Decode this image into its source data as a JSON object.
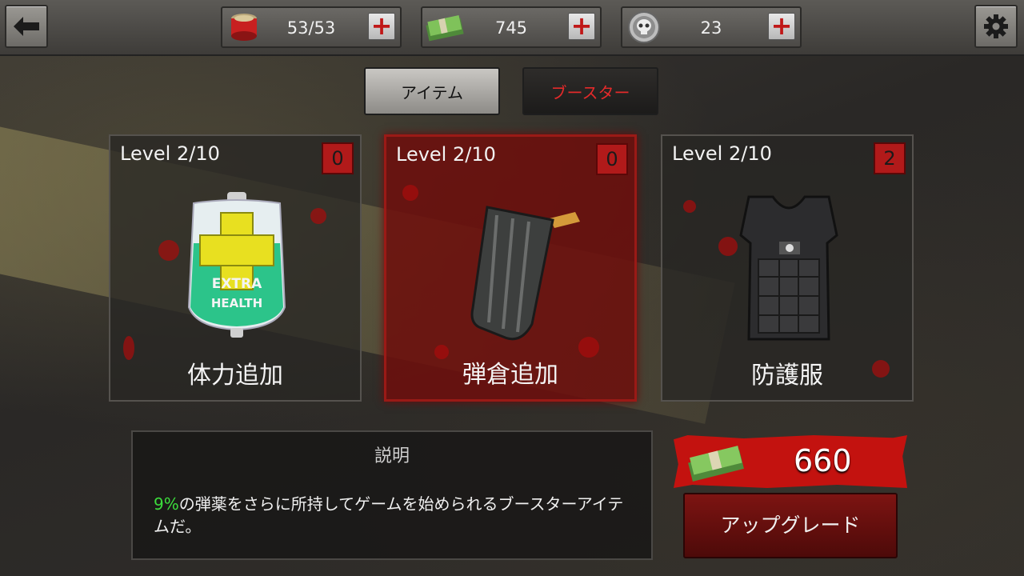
{
  "topbar": {
    "back_icon": "left-arrow-icon",
    "settings_icon": "gear-icon",
    "resources": [
      {
        "icon": "canned-food-icon",
        "value": "53/53",
        "plus": "+"
      },
      {
        "icon": "cash-stack-icon",
        "value": "745",
        "plus": "+"
      },
      {
        "icon": "skull-coin-icon",
        "value": "23",
        "plus": "+"
      }
    ]
  },
  "tabs": [
    {
      "label": "アイテム",
      "active": false
    },
    {
      "label": "ブースター",
      "active": true
    }
  ],
  "cards": [
    {
      "level": "Level  2/10",
      "count": "0",
      "name": "体力追加",
      "icon": "extra-health-bag-icon",
      "bag_text_1": "EXTRA",
      "bag_text_2": "HEALTH"
    },
    {
      "level": "Level  2/10",
      "count": "0",
      "name": "弾倉追加",
      "icon": "ammo-magazine-icon"
    },
    {
      "level": "Level  2/10",
      "count": "2",
      "name": "防護服",
      "icon": "body-armor-icon"
    }
  ],
  "description": {
    "title": "説明",
    "percent": "9%",
    "text": "の弾薬をさらに所持してゲームを始められるブースターアイテムだ。"
  },
  "price": {
    "icon": "cash-stack-icon",
    "amount": "660"
  },
  "upgrade_label": "アップグレード",
  "colors": {
    "accent_red": "#c3120f",
    "highlight_green": "#3cdc3c"
  }
}
